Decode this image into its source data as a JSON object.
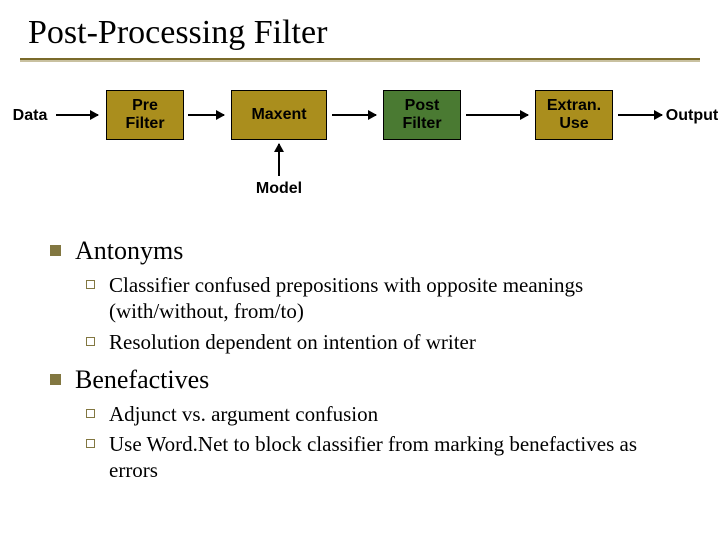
{
  "title": "Post-Processing Filter",
  "diagram": {
    "data": "Data",
    "prefilter": "Pre\nFilter",
    "maxent": "Maxent",
    "postfilter": "Post\nFilter",
    "extran": "Extran.\nUse",
    "output": "Output",
    "model": "Model"
  },
  "sections": [
    {
      "heading": "Antonyms",
      "points": [
        "Classifier confused prepositions with opposite meanings (with/without, from/to)",
        "Resolution dependent on intention of writer"
      ]
    },
    {
      "heading": "Benefactives",
      "points": [
        "Adjunct vs. argument confusion",
        "Use Word.Net to block classifier from marking benefactives as errors"
      ]
    }
  ]
}
